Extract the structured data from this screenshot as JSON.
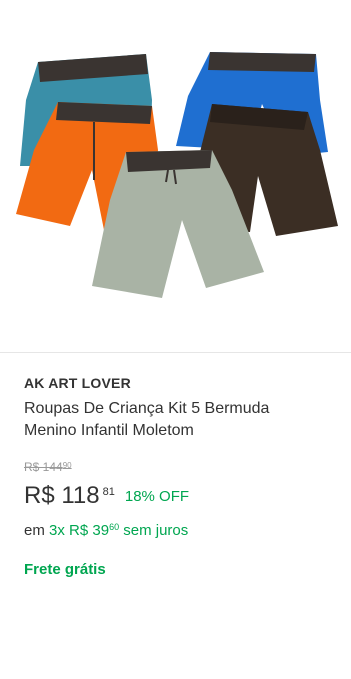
{
  "product": {
    "image_alt": "Kit 5 bermudas infantis de moletom coloridas",
    "brand": "AK ART LOVER",
    "title": "Roupas De Criança Kit 5 Bermuda Menino Infantil Moletom",
    "old_price_main": "R$ 144",
    "old_price_cents": "90",
    "price_main": "R$ 118",
    "price_cents": "81",
    "discount": "18% OFF",
    "installment_prefix": "em",
    "installment_count": "3x",
    "installment_value": "R$ 39",
    "installment_cents": "60",
    "installment_suffix": "sem juros",
    "shipping": "Frete grátis"
  },
  "colors": {
    "accent_green": "#00a650",
    "text_primary": "#333333",
    "text_muted": "#999999",
    "short_teal": "#3a8fa8",
    "short_blue": "#1f6fd1",
    "short_orange": "#f26a12",
    "short_brown": "#3b2e24",
    "short_gray": "#a9b3a5",
    "waistband": "#3a3431"
  }
}
